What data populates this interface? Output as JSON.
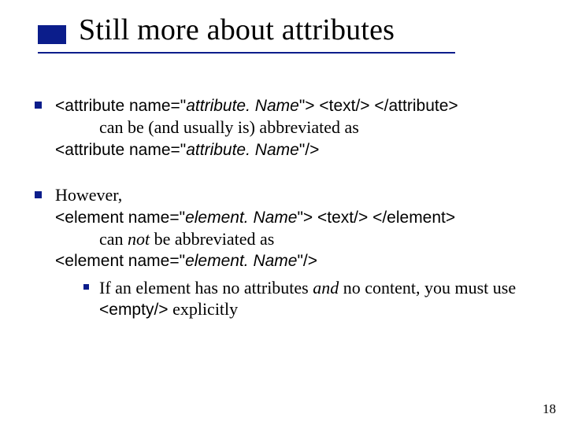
{
  "title": "Still more about attributes",
  "bullets": {
    "b1": {
      "code1_a": "<attribute name=\"",
      "code1_b": "attribute. Name",
      "code1_c": "\"> <text/> </attribute>",
      "line2a": "can be (and usually is) abbreviated as",
      "code2_a": "<attribute name=\"",
      "code2_b": "attribute. Name",
      "code2_c": "\"/>"
    },
    "b2": {
      "lead": "However,",
      "code1_a": "<element name=\"",
      "code1_b": "element. Name",
      "code1_c": "\"> <text/> </element>",
      "line2_a": "can ",
      "line2_b": "not",
      "line2_c": " be abbreviated as",
      "code2_a": "<element name=\"",
      "code2_b": "element. Name",
      "code2_c": "\"/>",
      "sub_a": "If an element has no attributes ",
      "sub_b": "and",
      "sub_c": " no content, you must use ",
      "sub_code": "<empty/>",
      "sub_d": " explicitly"
    }
  },
  "pagenum": "18"
}
